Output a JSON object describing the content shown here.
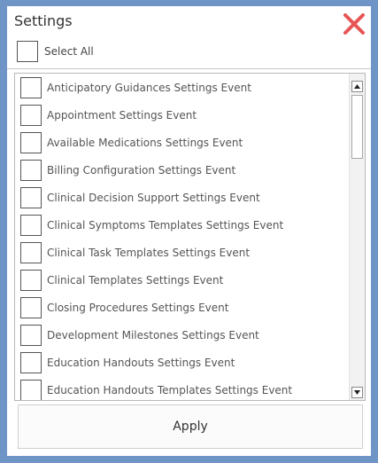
{
  "window": {
    "title": "Settings",
    "close_icon": "close-x-icon",
    "close_color": "#e85555"
  },
  "select_all": {
    "label": "Select All",
    "checked": false
  },
  "list": {
    "items": [
      {
        "label": "Anticipatory Guidances Settings Event",
        "checked": false
      },
      {
        "label": "Appointment Settings Event",
        "checked": false
      },
      {
        "label": "Available Medications Settings Event",
        "checked": false
      },
      {
        "label": "Billing Configuration Settings Event",
        "checked": false
      },
      {
        "label": "Clinical Decision Support Settings Event",
        "checked": false
      },
      {
        "label": "Clinical Symptoms Templates Settings Event",
        "checked": false
      },
      {
        "label": "Clinical Task Templates Settings Event",
        "checked": false
      },
      {
        "label": "Clinical Templates Settings Event",
        "checked": false
      },
      {
        "label": "Closing Procedures Settings Event",
        "checked": false
      },
      {
        "label": "Development Milestones Settings Event",
        "checked": false
      },
      {
        "label": "Education Handouts Settings Event",
        "checked": false
      },
      {
        "label": "Education Handouts Templates Settings Event",
        "checked": false
      }
    ],
    "scroll_up_icon": "arrow-up-icon",
    "scroll_down_icon": "arrow-down-icon"
  },
  "footer": {
    "apply_label": "Apply"
  },
  "colors": {
    "background": "#6f95c7",
    "panel": "#ffffff",
    "close": "#e85555"
  }
}
